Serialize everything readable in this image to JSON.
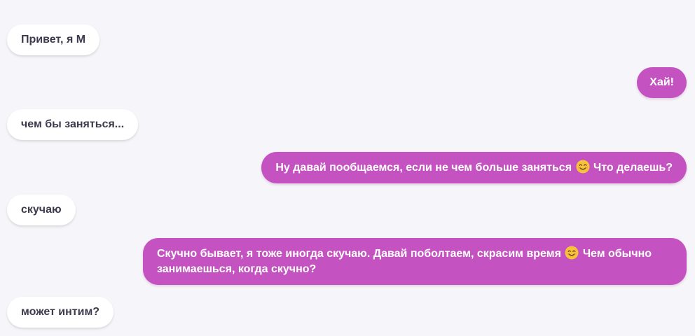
{
  "messages": [
    {
      "id": "m1",
      "side": "incoming",
      "text": "Привет, я М"
    },
    {
      "id": "m2",
      "side": "outgoing",
      "text": "Хай!"
    },
    {
      "id": "m3",
      "side": "incoming",
      "text": "чем бы заняться..."
    },
    {
      "id": "m4",
      "side": "outgoing",
      "text_before": "Ну давай пообщаемся, если не чем больше заняться",
      "emoji": "smiling-face-emoji",
      "text_after": "Что делаешь?"
    },
    {
      "id": "m5",
      "side": "incoming",
      "text": "скучаю"
    },
    {
      "id": "m6",
      "side": "outgoing",
      "text_before": "Скучно бывает, я тоже иногда скучаю. Давай поболтаем, скрасим время",
      "emoji": "smiling-face-emoji",
      "text_after": "Чем обычно занимаешься, когда скучно?"
    },
    {
      "id": "m7",
      "side": "incoming",
      "text": "может интим?"
    }
  ],
  "colors": {
    "background": "#f6f5f9",
    "incoming_bubble": "#ffffff",
    "incoming_text": "#3d3a4d",
    "outgoing_bubble": "#c452c0",
    "outgoing_text": "#ffffff"
  }
}
